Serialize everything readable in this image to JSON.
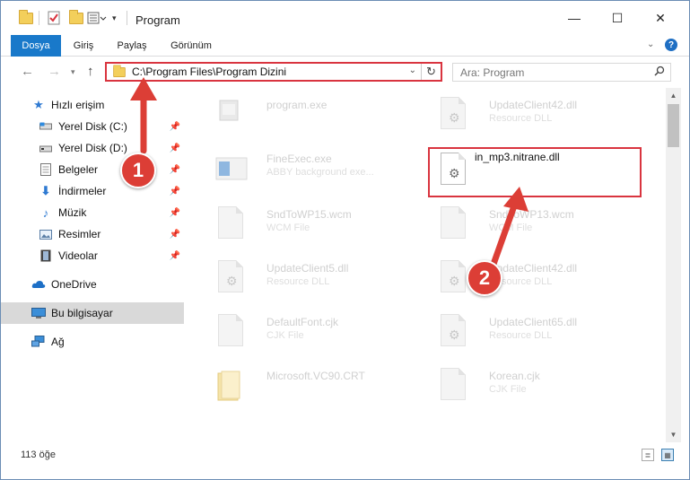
{
  "window": {
    "title": "Program",
    "min_icon": "minimize-icon",
    "max_icon": "maximize-icon",
    "close_icon": "close-icon"
  },
  "ribbon": {
    "tabs": [
      "Dosya",
      "Giriş",
      "Paylaş",
      "Görünüm"
    ],
    "help": "?"
  },
  "nav": {
    "address": "C:\\Program Files\\Program Dizini",
    "search_placeholder": "Ara: Program"
  },
  "sidebar": {
    "items": [
      {
        "label": "Hızlı erişim",
        "icon": "star-icon"
      },
      {
        "label": "Yerel Disk (C:)",
        "icon": "drive-icon"
      },
      {
        "label": "Yerel Disk (D:)",
        "icon": "drive-icon"
      },
      {
        "label": "Belgeler",
        "icon": "documents-icon"
      },
      {
        "label": "İndirmeler",
        "icon": "download-icon"
      },
      {
        "label": "Müzik",
        "icon": "music-icon"
      },
      {
        "label": "Resimler",
        "icon": "pictures-icon"
      },
      {
        "label": "Videolar",
        "icon": "videos-icon"
      },
      {
        "label": "OneDrive",
        "icon": "cloud-icon"
      },
      {
        "label": "Bu bilgisayar",
        "icon": "computer-icon"
      },
      {
        "label": "Ağ",
        "icon": "network-icon"
      }
    ]
  },
  "files": [
    {
      "name": "program.exe",
      "type": ""
    },
    {
      "name": "UpdateClient42.dll",
      "type": "Resource DLL"
    },
    {
      "name": "FineExec.exe",
      "type": "ABBY background exe..."
    },
    {
      "name": "in_mp3.nitrane.dll",
      "type": ""
    },
    {
      "name": "SndToWP15.wcm",
      "type": "WCM File"
    },
    {
      "name": "SndToWP13.wcm",
      "type": "WCM File"
    },
    {
      "name": "UpdateClient5.dll",
      "type": "Resource DLL"
    },
    {
      "name": "UpdateClient42.dll",
      "type": "Resource DLL"
    },
    {
      "name": "DefaultFont.cjk",
      "type": "CJK File"
    },
    {
      "name": "UpdateClient65.dll",
      "type": "Resource DLL"
    },
    {
      "name": "Microsoft.VC90.CRT",
      "type": ""
    },
    {
      "name": "Korean.cjk",
      "type": "CJK File"
    }
  ],
  "status": {
    "count": "113 öğe"
  },
  "annotations": {
    "step1": "1",
    "step2": "2",
    "color": "#dc3e36"
  }
}
